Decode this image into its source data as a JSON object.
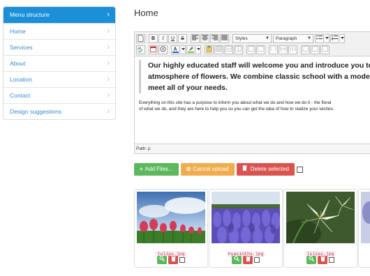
{
  "sidebar": {
    "items": [
      {
        "label": "Menu structure",
        "active": true
      },
      {
        "label": "Home"
      },
      {
        "label": "Services"
      },
      {
        "label": "About"
      },
      {
        "label": "Location"
      },
      {
        "label": "Contact"
      },
      {
        "label": "Design suggestions"
      }
    ],
    "chevron": "›"
  },
  "page": {
    "title": "Home"
  },
  "editor": {
    "toolbar": {
      "styles_label": "Styles",
      "format_label": "Paragraph",
      "bold": "B",
      "italic": "I",
      "underline": "U",
      "strike": "S",
      "icons": [
        "new-document-icon",
        "bold-icon",
        "italic-icon",
        "underline-icon",
        "strikethrough-icon",
        "align-left-icon",
        "align-center-icon",
        "align-right-icon",
        "justify-icon",
        "bullet-list-icon",
        "numbered-list-icon",
        "spellcheck-icon",
        "date-icon",
        "preview-icon",
        "text-color-icon",
        "highlight-icon",
        "paste-icon",
        "table-icon",
        "link-icon",
        "anchor-icon"
      ]
    },
    "quote_lines": [
      "Our highly educated staff will welcome you and introduce you to",
      "atmosphere of flowers. We combine classic school with a modern",
      "meet all of your needs."
    ],
    "body_lines": [
      "Everything on this site has a purpose to inform you about what we do and how we do it - the floral",
      "of what we do, and they are here to help you so you can get the idea of how to realize your wishes."
    ],
    "path": "Path: p"
  },
  "actions": {
    "add_files": "Add Files...",
    "cancel_upload": "Cancel upload",
    "delete_selected": "Delete selected"
  },
  "gallery": {
    "items": [
      {
        "file": "tulips.jpg"
      },
      {
        "file": "hyacinths.jpg"
      },
      {
        "file": "lilies.jpg"
      }
    ]
  },
  "colors": {
    "accent": "#1b8fd8",
    "link": "#3a8bd0",
    "success": "#5cb85c",
    "warning": "#f0ad4e",
    "danger": "#d9534f"
  }
}
